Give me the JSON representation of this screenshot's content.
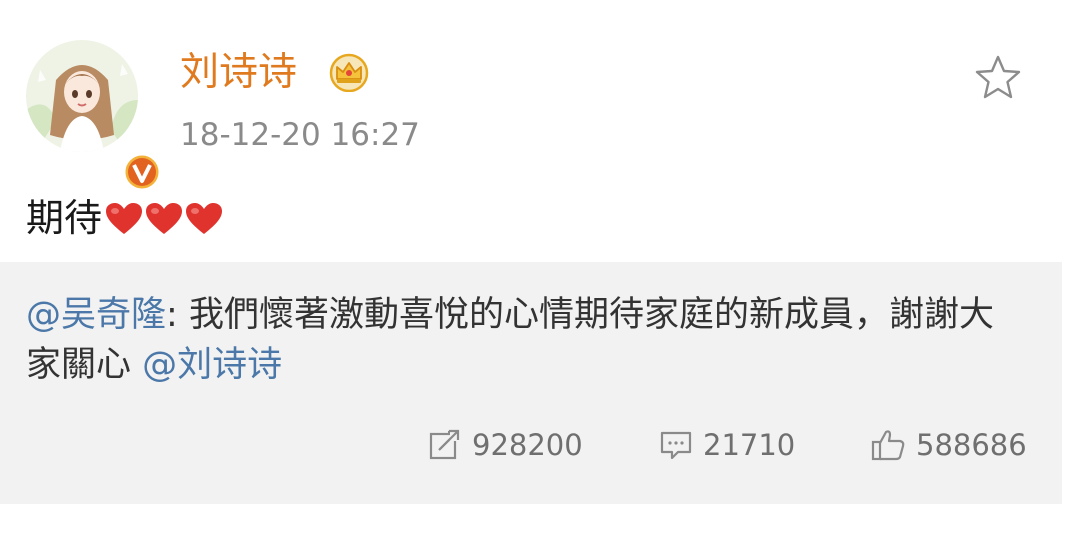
{
  "author": {
    "name": "刘诗诗",
    "avatar_icon": "cartoon-girl-avatar",
    "verified_badge": "V",
    "verified_color": "#e2631f",
    "vip_icon": "crown-icon",
    "name_color": "#e07a1f"
  },
  "post": {
    "timestamp": "18-12-20 16:27",
    "text": "期待",
    "emoji": [
      "red-heart",
      "red-heart",
      "red-heart"
    ]
  },
  "retweet": {
    "mention_author": "@吴奇隆",
    "separator": ":",
    "body": " 我們懷著激動喜悅的心情期待家庭的新成員，謝謝大家關心 ",
    "mention_end": "@刘诗诗",
    "mention_color": "#4b78a8",
    "stats": {
      "reposts": "928200",
      "comments": "21710",
      "likes": "588686"
    }
  },
  "icons": {
    "favorite": "star-outline-icon",
    "repost": "repost-icon",
    "comment": "comment-icon",
    "like": "thumbs-up-icon"
  }
}
